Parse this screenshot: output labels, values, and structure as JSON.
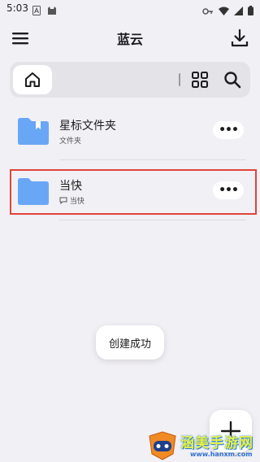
{
  "status_bar": {
    "time": "5:03"
  },
  "app": {
    "title": "蓝云"
  },
  "files": [
    {
      "name": "星标文件夹",
      "subtitle": "文件夹"
    },
    {
      "name": "当快",
      "subtitle": "当快"
    }
  ],
  "toast": {
    "text": "创建成功"
  },
  "watermark": {
    "text": "涵美手游网",
    "url": "www.hanxm.com"
  },
  "colors": {
    "accent_folder": "#6aa6f6",
    "highlight": "#e0443e",
    "background": "#f1f0f5"
  }
}
